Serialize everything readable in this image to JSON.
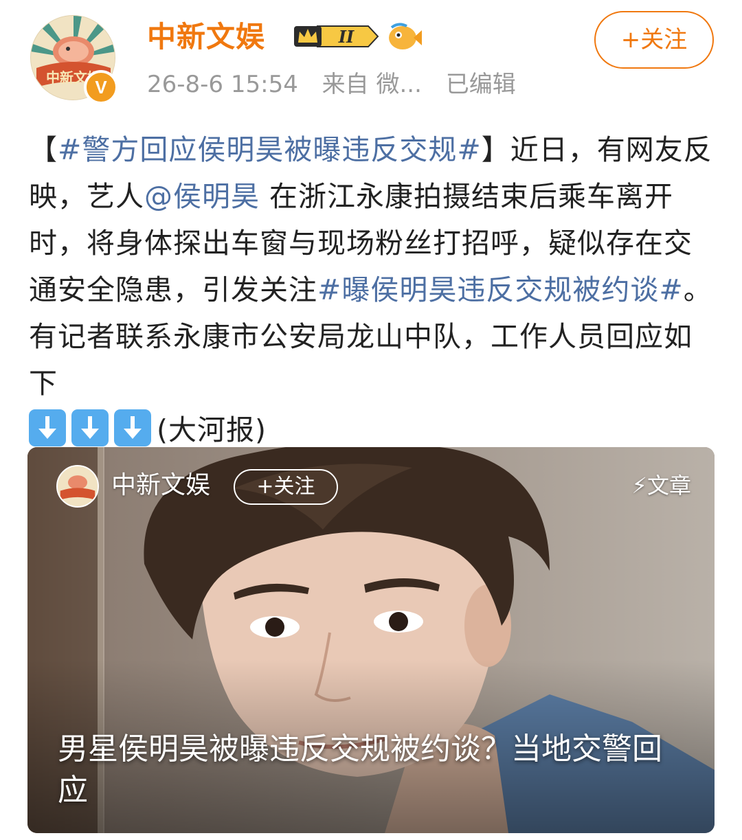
{
  "header": {
    "user_name": "中新文娱",
    "verified_mark": "V",
    "level_badge": "II",
    "follow_label": "+关注",
    "timestamp": "26-8-6 15:54",
    "source": "来自 微...",
    "edited": "已编辑",
    "avatar_text": "中新文娱"
  },
  "post": {
    "bracket_open": "【",
    "hashtag1": "#警方回应侯明昊被曝违反交规#",
    "bracket_close": "】",
    "text1": "近日，有网友反映，艺人",
    "mention": "@侯明昊",
    "text2": " 在浙江永康拍摄结束后乘车离开时，将身体探出车窗与现场粉丝打招呼，疑似存在交通安全隐患，引发关注",
    "hashtag2": "#曝侯明昊违反交规被约谈#",
    "text3": "。有记者联系永康市公安局龙山中队，工作人员回应如下",
    "arrow_icon": "down-arrow-emoji",
    "source_note": "(大河报)"
  },
  "card": {
    "author": "中新文娱",
    "follow_label": "+关注",
    "type_label": "文章",
    "title": "男星侯明昊被曝违反交规被约谈？当地交警回应"
  },
  "colors": {
    "brand_orange": "#f0780f",
    "link_blue": "#4d6fa3",
    "meta_gray": "#999999"
  }
}
